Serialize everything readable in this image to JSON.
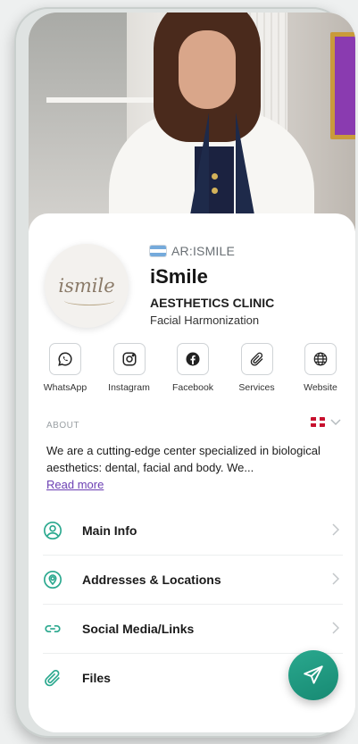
{
  "profile": {
    "code": "AR:ISMILE",
    "name": "iSmile",
    "subtitle": "AESTHETICS CLINIC",
    "tagline": "Facial Harmonization",
    "logo_text": "ismile",
    "flag": "argentina-flag-icon"
  },
  "socials": [
    {
      "label": "WhatsApp",
      "icon": "whatsapp-icon"
    },
    {
      "label": "Instagram",
      "icon": "instagram-icon"
    },
    {
      "label": "Facebook",
      "icon": "facebook-icon"
    },
    {
      "label": "Services",
      "icon": "paperclip-icon"
    },
    {
      "label": "Website",
      "icon": "globe-icon"
    }
  ],
  "about": {
    "heading": "ABOUT",
    "language_flag": "uk-flag-icon",
    "text": "We are a cutting-edge center specialized in biological aesthetics: dental, facial and body. We...",
    "read_more": "Read more"
  },
  "menu": [
    {
      "label": "Main Info",
      "icon": "person-circle-icon"
    },
    {
      "label": "Addresses & Locations",
      "icon": "location-pin-icon"
    },
    {
      "label": "Social Media/Links",
      "icon": "link-icon"
    },
    {
      "label": "Files",
      "icon": "paperclip-icon"
    }
  ],
  "colors": {
    "accent": "#2aa88e",
    "link": "#6b3fb3"
  }
}
